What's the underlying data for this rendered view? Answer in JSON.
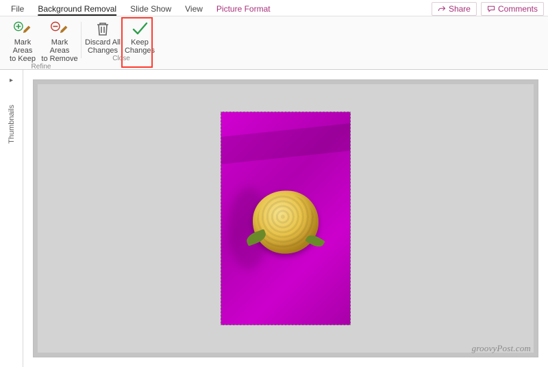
{
  "tabs": {
    "file": "File",
    "bgremove": "Background Removal",
    "slideshow": "Slide Show",
    "view": "View",
    "picfmt": "Picture Format"
  },
  "actions": {
    "share": "Share",
    "comments": "Comments"
  },
  "ribbon": {
    "refine_group": "Refine",
    "close_group": "Close",
    "mark_keep_l1": "Mark Areas",
    "mark_keep_l2": "to Keep",
    "mark_remove_l1": "Mark Areas",
    "mark_remove_l2": "to Remove",
    "discard_l1": "Discard All",
    "discard_l2": "Changes",
    "keep_l1": "Keep",
    "keep_l2": "Changes"
  },
  "sidebar": {
    "thumbnails": "Thumbnails"
  },
  "watermark": "groovyPost.com",
  "colors": {
    "accent": "#a8317a",
    "mask": "#c400c4",
    "highlight": "#ff3b2f"
  }
}
